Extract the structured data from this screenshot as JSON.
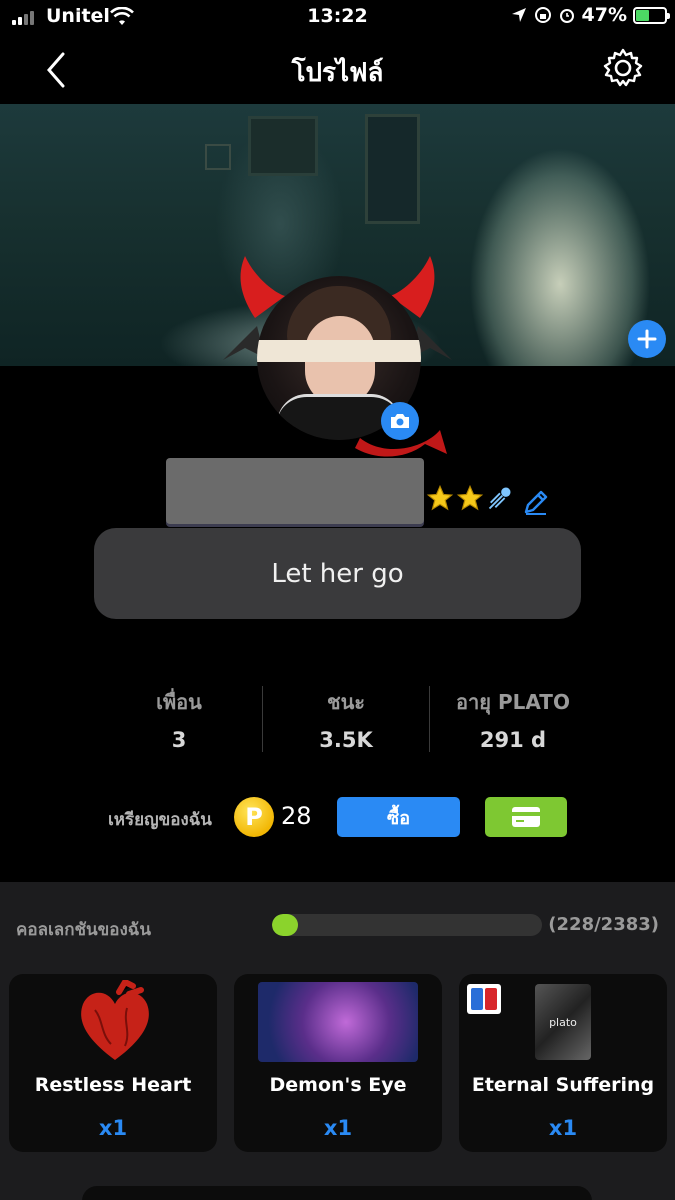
{
  "status_bar": {
    "carrier": "Unitel",
    "time": "13:22",
    "battery": "47%",
    "battery_level": 0.47
  },
  "nav": {
    "title": "โปรไฟล์"
  },
  "profile": {
    "bio": "Let her go"
  },
  "stats": [
    {
      "label": "เพื่อน",
      "value": "3"
    },
    {
      "label": "ชนะ",
      "value": "3.5K"
    },
    {
      "label": "อายุ PLATO",
      "value": "291 d"
    }
  ],
  "coins": {
    "label": "เหรียญของฉัน",
    "symbol": "P",
    "count": "28",
    "buy_label": "ซื้อ"
  },
  "collection": {
    "title": "คอลเลกชันของฉัน",
    "progress_text": "(228/2383)",
    "progress_fraction": 0.0957,
    "items": [
      {
        "name": "Restless Heart",
        "qty": "x1"
      },
      {
        "name": "Demon's Eye",
        "qty": "x1"
      },
      {
        "name": "Eternal Suffering",
        "qty": "x1",
        "image_text": "plato"
      }
    ]
  },
  "colors": {
    "accent": "#2a8af4",
    "green": "#7ec832",
    "progress": "#8bd32c",
    "coin": "#f2b705"
  }
}
